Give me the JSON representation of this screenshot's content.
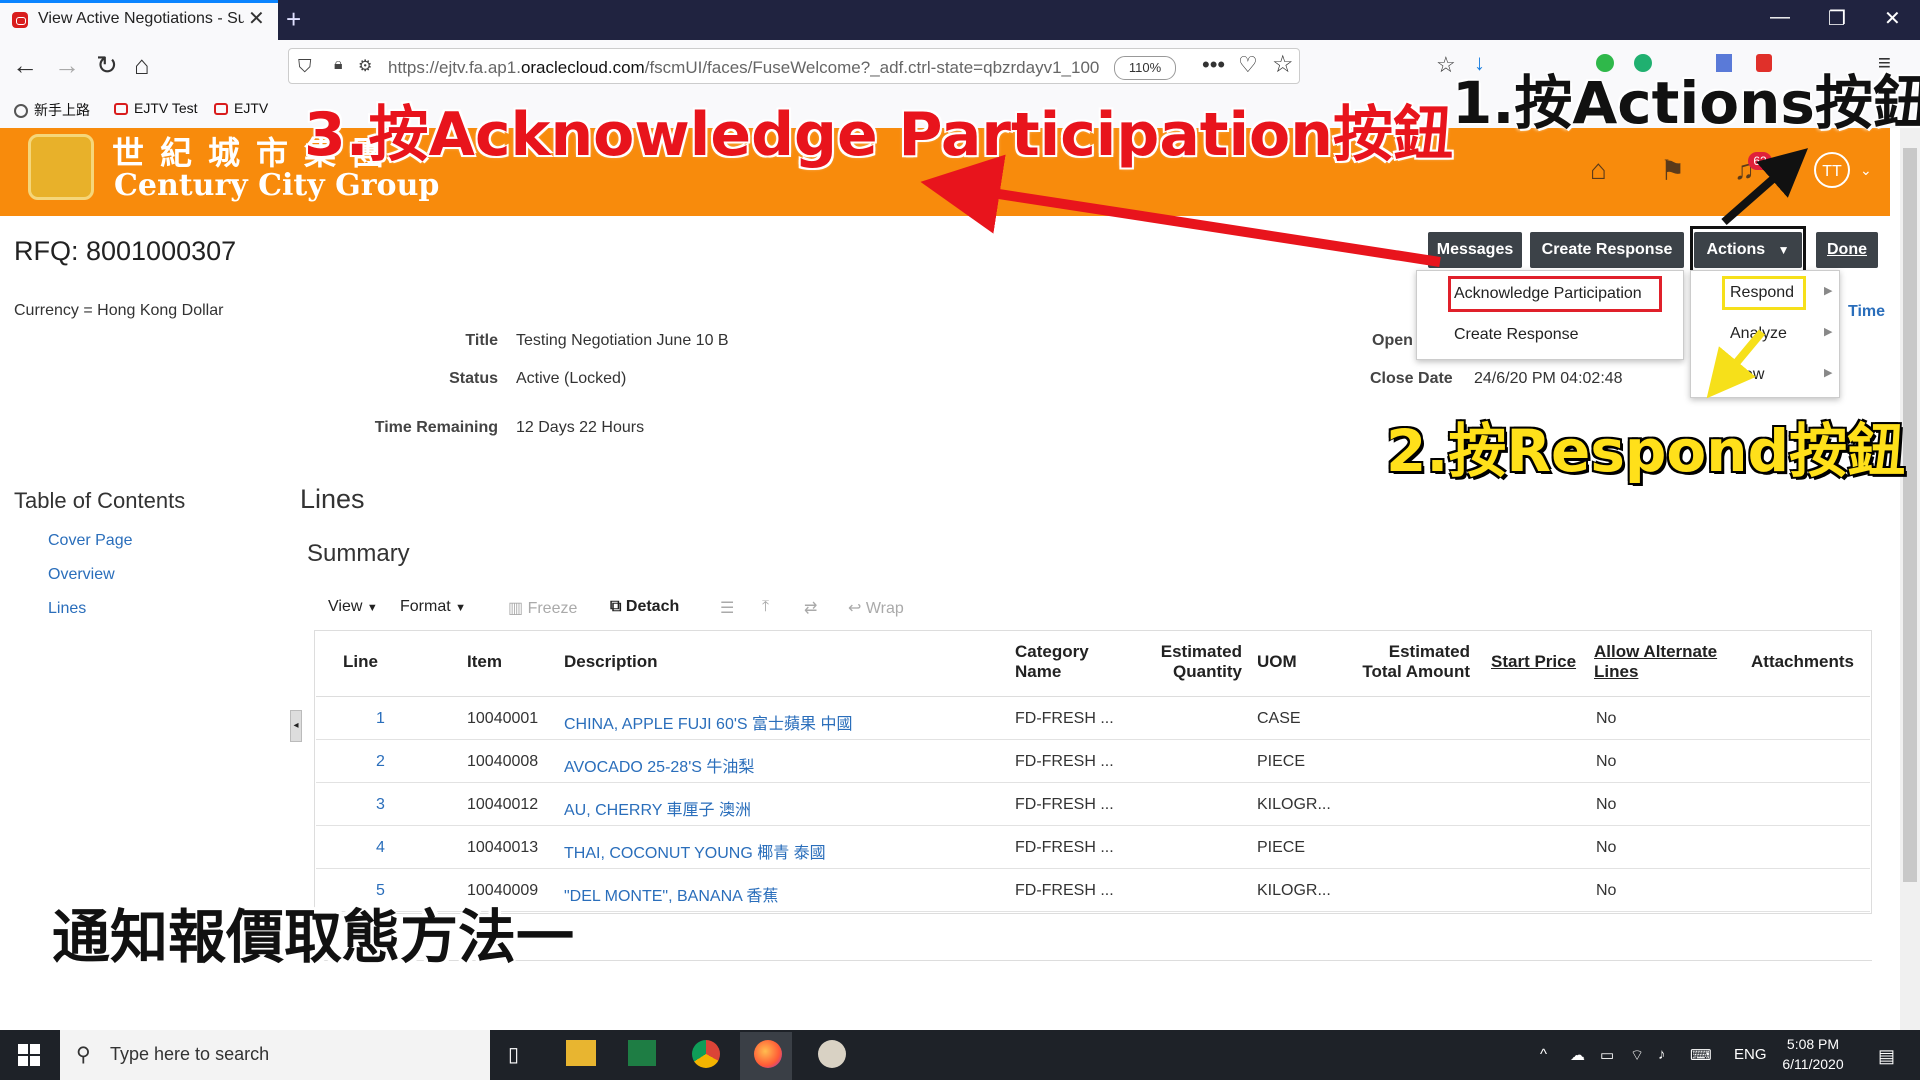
{
  "browser": {
    "tab_title": "View Active Negotiations - Sup",
    "url_prefix": "https://ejtv.fa.ap1.",
    "url_domain": "oraclecloud.com",
    "url_path": "/fscmUI/faces/FuseWelcome?_adf.ctrl-state=qbzrdayv1_100",
    "zoom": "110%",
    "bookmarks": [
      "新手上路",
      "EJTV Test",
      "EJTV"
    ]
  },
  "header": {
    "logo_chinese": "世紀城市集團",
    "logo_english": "Century City Group",
    "notification_count": "62",
    "avatar_initials": "TT"
  },
  "page": {
    "title": "RFQ: 8001000307",
    "currency": "Currency = Hong Kong Dollar",
    "fields": {
      "title_label": "Title",
      "title_value": "Testing Negotiation June 10 B",
      "status_label": "Status",
      "status_value": "Active (Locked)",
      "time_label": "Time Remaining",
      "time_value": "12 Days 22 Hours",
      "open_label": "Open",
      "close_label": "Close Date",
      "close_value": "24/6/20 PM 04:02:48",
      "time_link": "Time"
    },
    "buttons": {
      "messages": "Messages",
      "create_response": "Create Response",
      "actions": "Actions",
      "done": "Done"
    },
    "actions_menu": [
      "Respond",
      "Analyze",
      "View"
    ],
    "respond_menu": [
      "Acknowledge Participation",
      "Create Response"
    ],
    "toc": {
      "title": "Table of Contents",
      "links": [
        "Cover Page",
        "Overview",
        "Lines"
      ]
    },
    "lines_heading": "Lines",
    "summary_heading": "Summary",
    "toolbar": {
      "view": "View",
      "format": "Format",
      "freeze": "Freeze",
      "detach": "Detach",
      "wrap": "Wrap"
    }
  },
  "table": {
    "headers": {
      "line": "Line",
      "item": "Item",
      "description": "Description",
      "category_1": "Category",
      "category_2": "Name",
      "qty_1": "Estimated",
      "qty_2": "Quantity",
      "uom": "UOM",
      "total_1": "Estimated",
      "total_2": "Total Amount",
      "start_price": "Start Price",
      "alt_1": "Allow Alternate",
      "alt_2": "Lines",
      "attachments": "Attachments"
    },
    "rows": [
      {
        "line": "1",
        "item": "10040001",
        "description": "CHINA, APPLE FUJI 60'S 富士蘋果 中國",
        "category": "FD-FRESH ...",
        "uom": "CASE",
        "alt": "No"
      },
      {
        "line": "2",
        "item": "10040008",
        "description": "AVOCADO 25-28'S 牛油梨",
        "category": "FD-FRESH ...",
        "uom": "PIECE",
        "alt": "No"
      },
      {
        "line": "3",
        "item": "10040012",
        "description": "AU, CHERRY 車厘子 澳洲",
        "category": "FD-FRESH ...",
        "uom": "KILOGR...",
        "alt": "No"
      },
      {
        "line": "4",
        "item": "10040013",
        "description": "THAI, COCONUT YOUNG 椰青 泰國",
        "category": "FD-FRESH ...",
        "uom": "PIECE",
        "alt": "No"
      },
      {
        "line": "5",
        "item": "10040009",
        "description": "\"DEL MONTE\", BANANA 香蕉",
        "category": "FD-FRESH ...",
        "uom": "KILOGR...",
        "alt": "No"
      }
    ]
  },
  "annotations": {
    "step1": "1.按Actions按鈕",
    "step2": "2.按Respond按鈕",
    "step3": "3.按Acknowledge Participation按鈕",
    "caption": "通知報價取態方法一"
  },
  "taskbar": {
    "search_placeholder": "Type here to search",
    "language": "ENG",
    "time": "5:08 PM",
    "date": "6/11/2020"
  },
  "colors": {
    "banner": "#f88b0c",
    "button": "#3c4248",
    "link": "#2a6ebb",
    "highlight_red": "#e0202a",
    "highlight_yellow": "#f6e01a"
  }
}
